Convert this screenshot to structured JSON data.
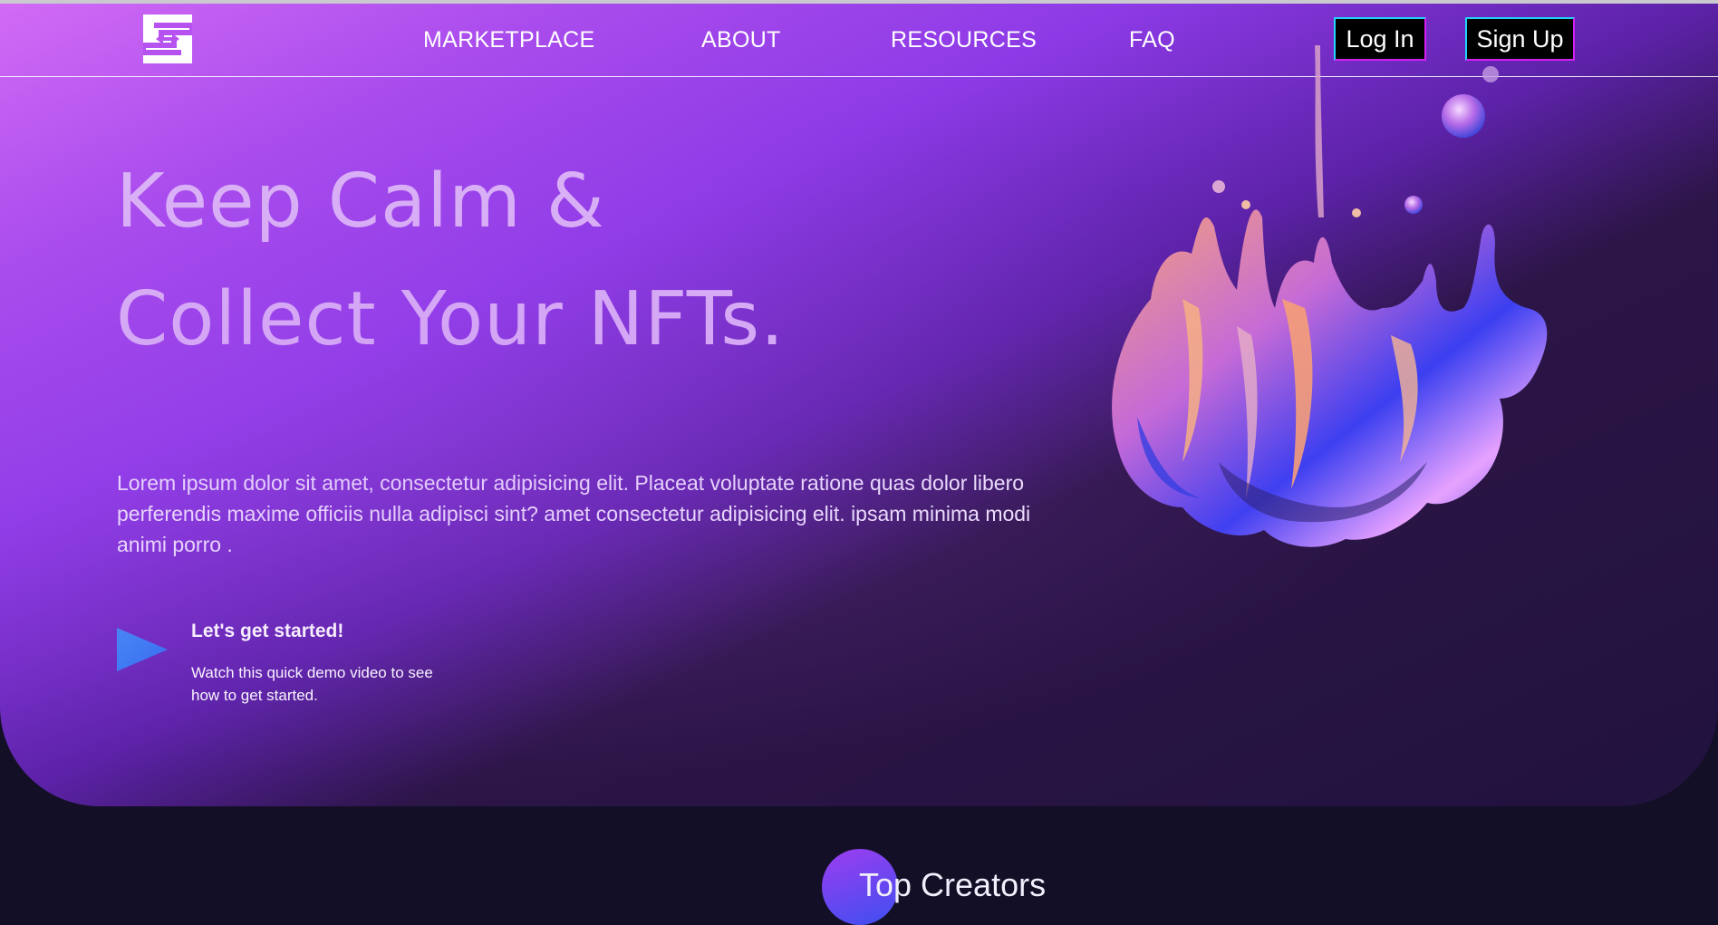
{
  "nav": {
    "logo_icon": "s-logo-icon",
    "links": [
      "MARKETPLACE",
      "ABOUT",
      "RESOURCES",
      "FAQ"
    ],
    "login_label": "Log In",
    "signup_label": "Sign Up"
  },
  "hero": {
    "headline_line1": "Keep Calm &",
    "headline_line2": "Collect Your NFTs.",
    "body": "Lorem ipsum dolor sit amet, consectetur adipisicing elit. Placeat voluptate ratione quas dolor libero perferendis maxime officiis nulla adipisci sint? amet consectetur adipisicing elit. ipsam minima modi animi porro .",
    "cta_title": "Let's get started!",
    "cta_sub": "Watch this quick demo video to see how to get started.",
    "play_icon": "play-icon",
    "art": "liquid-splash-illustration"
  },
  "section": {
    "title": "Top Creators"
  },
  "colors": {
    "accent_cyan": "#21d4fd",
    "accent_magenta": "#d51ef0",
    "headline": "#dcb6f6",
    "background": "#130f26"
  }
}
